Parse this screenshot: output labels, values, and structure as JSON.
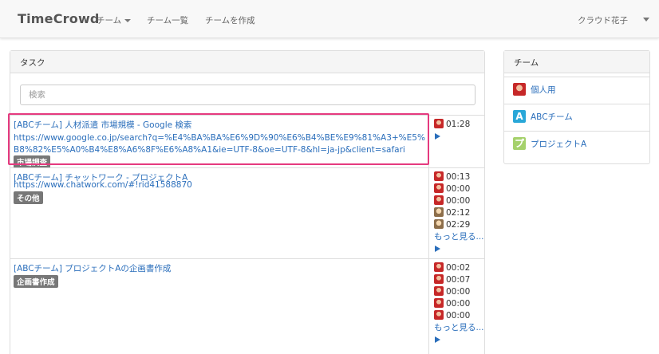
{
  "navbar": {
    "brand": "TimeCrowd",
    "menu_team": "チーム",
    "menu_team_list": "チーム一覧",
    "menu_create_team": "チームを作成",
    "user_name": "クラウド花子"
  },
  "tasks_panel": {
    "heading": "タスク",
    "search_placeholder": "検索",
    "more_label": "もっと見る...",
    "tasks": [
      {
        "title": "[ABCチーム] 人材派遣 市場規模 - Google 検索",
        "url_line1": "https://www.google.co.jp/search?q=%E4%BA%BA%E6%9D%90%E6%B4%BE%E9%81%A3+%E5%",
        "url_line2": "B8%82%E5%A0%B4%E8%A6%8F%E6%A8%A1&ie=UTF-8&oe=UTF-8&hl=ja-jp&client=safari",
        "category": "市場調査",
        "times": [
          "01:28"
        ]
      },
      {
        "title": "[ABCチーム] チャットワーク - プロジェクトA",
        "url_line1": "https://www.chatwork.com/#!rid41588870",
        "category": "その他",
        "times": [
          "00:13",
          "00:00",
          "00:00",
          "02:12",
          "02:29"
        ]
      },
      {
        "title": "[ABCチーム] プロジェクトAの企画書作成",
        "category": "企画書作成",
        "times": [
          "00:02",
          "00:07",
          "00:00",
          "00:00",
          "00:00"
        ]
      }
    ]
  },
  "teams_panel": {
    "heading": "チーム",
    "teams": [
      {
        "name": "個人用",
        "icon": "avatar-photo"
      },
      {
        "name": "ABCチーム",
        "icon_letter": "A",
        "color": "#29a7d8"
      },
      {
        "name": "プロジェクトA",
        "icon_letter": "プ",
        "color": "#a5d16b"
      }
    ]
  },
  "colors": {
    "link": "#2a6ebb",
    "badge": "#777777",
    "highlight": "#e53a7f"
  }
}
